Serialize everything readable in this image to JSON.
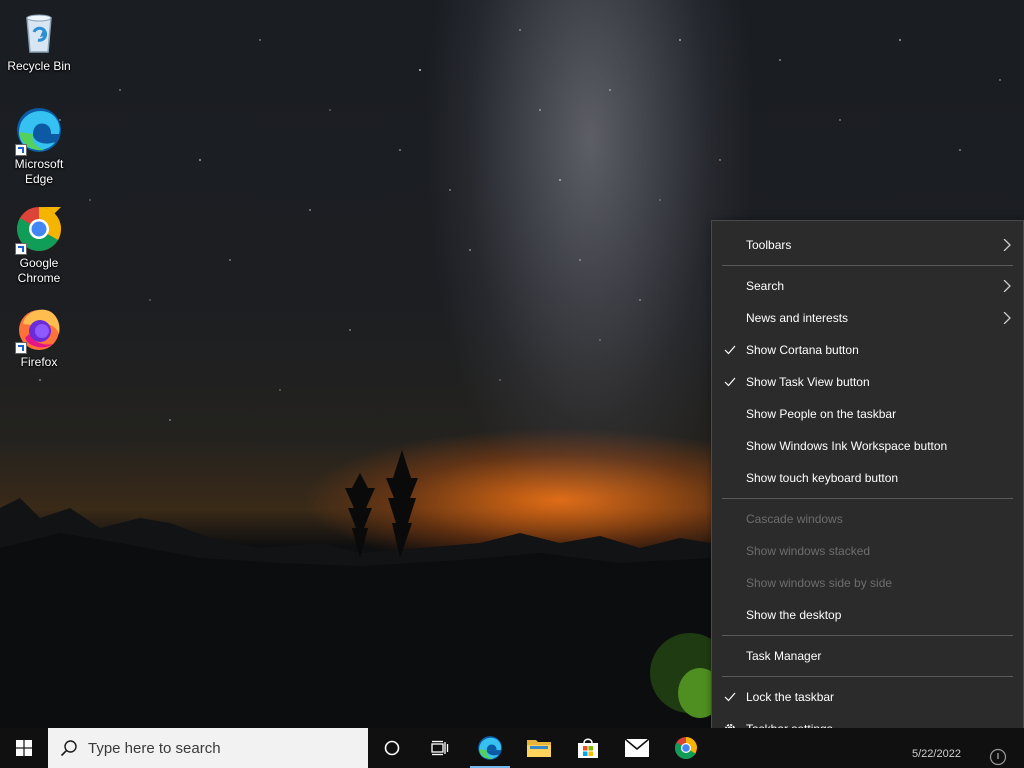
{
  "desktop": {
    "icons": [
      {
        "name": "recycle-bin",
        "label": "Recycle Bin"
      },
      {
        "name": "microsoft-edge",
        "label": "Microsoft Edge"
      },
      {
        "name": "google-chrome",
        "label": "Google Chrome"
      },
      {
        "name": "firefox",
        "label": "Firefox"
      }
    ]
  },
  "context_menu": {
    "items": [
      {
        "label": "Toolbars",
        "submenu": true,
        "checked": false,
        "enabled": true
      },
      {
        "label": "Search",
        "submenu": true,
        "checked": false,
        "enabled": true
      },
      {
        "label": "News and interests",
        "submenu": true,
        "checked": false,
        "enabled": true
      },
      {
        "label": "Show Cortana button",
        "submenu": false,
        "checked": true,
        "enabled": true
      },
      {
        "label": "Show Task View button",
        "submenu": false,
        "checked": true,
        "enabled": true
      },
      {
        "label": "Show People on the taskbar",
        "submenu": false,
        "checked": false,
        "enabled": true
      },
      {
        "label": "Show Windows Ink Workspace button",
        "submenu": false,
        "checked": false,
        "enabled": true
      },
      {
        "label": "Show touch keyboard button",
        "submenu": false,
        "checked": false,
        "enabled": true
      },
      {
        "label": "Cascade windows",
        "submenu": false,
        "checked": false,
        "enabled": false
      },
      {
        "label": "Show windows stacked",
        "submenu": false,
        "checked": false,
        "enabled": false
      },
      {
        "label": "Show windows side by side",
        "submenu": false,
        "checked": false,
        "enabled": false
      },
      {
        "label": "Show the desktop",
        "submenu": false,
        "checked": false,
        "enabled": true
      },
      {
        "label": "Task Manager",
        "submenu": false,
        "checked": false,
        "enabled": true
      },
      {
        "label": "Lock the taskbar",
        "submenu": false,
        "checked": true,
        "enabled": true
      },
      {
        "label": "Taskbar settings",
        "submenu": false,
        "checked": false,
        "enabled": true,
        "icon": "gear-icon"
      }
    ]
  },
  "taskbar": {
    "search_placeholder": "Type here to search",
    "pinned": [
      "start-icon",
      "cortana-icon",
      "task-view-icon",
      "edge-icon",
      "file-explorer-icon",
      "store-icon",
      "mail-icon",
      "chrome-icon"
    ],
    "active_app": "edge-icon",
    "accent": "#76b9ed",
    "tray_date": "5/22/2022"
  },
  "colors": {
    "menu_bg": "#2b2b2b",
    "taskbar_bg": "#101010",
    "disabled_text": "#6d6d6d"
  }
}
